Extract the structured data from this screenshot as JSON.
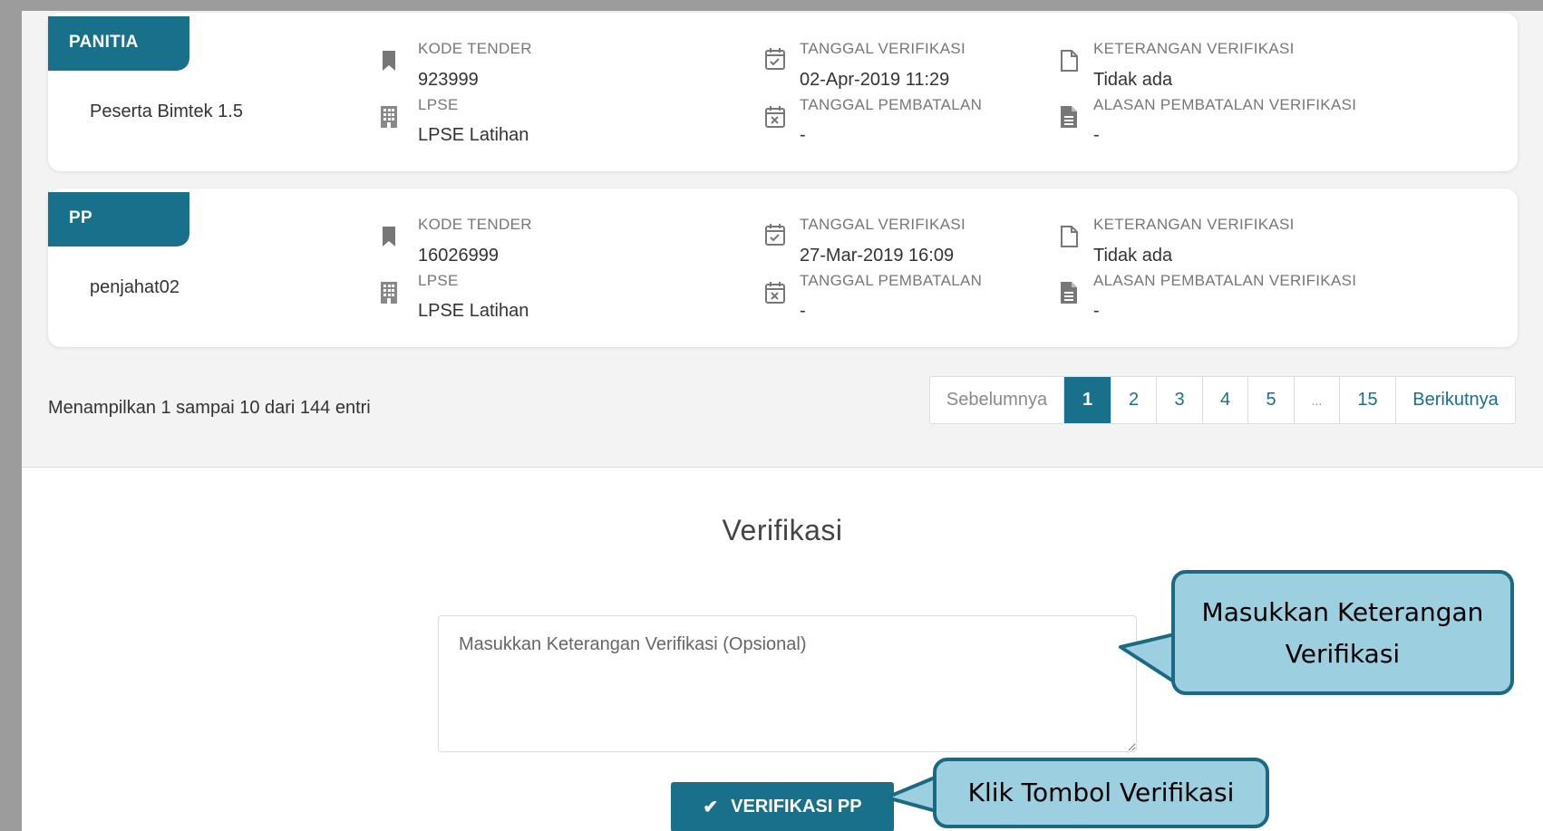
{
  "cards": [
    {
      "role": "PANITIA",
      "name": "Peserta Bimtek 1.5",
      "kode_tender_label": "KODE TENDER",
      "kode_tender": "923999",
      "lpse_label": "LPSE",
      "lpse": "LPSE Latihan",
      "tgl_verifikasi_label": "TANGGAL VERIFIKASI",
      "tgl_verifikasi": "02-Apr-2019 11:29",
      "tgl_pembatalan_label": "TANGGAL PEMBATALAN",
      "tgl_pembatalan": "-",
      "keterangan_label": "KETERANGAN VERIFIKASI",
      "keterangan": "Tidak ada",
      "alasan_label": "ALASAN PEMBATALAN VERIFIKASI",
      "alasan": "-"
    },
    {
      "role": "PP",
      "name": "penjahat02",
      "kode_tender_label": "KODE TENDER",
      "kode_tender": "16026999",
      "lpse_label": "LPSE",
      "lpse": "LPSE Latihan",
      "tgl_verifikasi_label": "TANGGAL VERIFIKASI",
      "tgl_verifikasi": "27-Mar-2019 16:09",
      "tgl_pembatalan_label": "TANGGAL PEMBATALAN",
      "tgl_pembatalan": "-",
      "keterangan_label": "KETERANGAN VERIFIKASI",
      "keterangan": "Tidak ada",
      "alasan_label": "ALASAN PEMBATALAN VERIFIKASI",
      "alasan": "-"
    }
  ],
  "info": "Menampilkan 1 sampai 10 dari 144 entri",
  "pagination": {
    "prev": "Sebelumnya",
    "pages": [
      "1",
      "2",
      "3",
      "4",
      "5",
      "...",
      "15"
    ],
    "active": "1",
    "next": "Berikutnya"
  },
  "verification": {
    "heading": "Verifikasi",
    "textarea_placeholder": "Masukkan Keterangan Verifikasi (Opsional)",
    "button_label": "VERIFIKASI PP",
    "button_icon": "check-icon"
  },
  "callouts": {
    "textarea_note_line1": "Masukkan Keterangan",
    "textarea_note_line2": "Verifikasi",
    "button_note": "Klik Tombol Verifikasi"
  },
  "colors": {
    "primary": "#18708a",
    "callout_fill": "#9ccfe0",
    "callout_border": "#1b6a84"
  },
  "icons": {
    "kode_tender": "bookmark-icon",
    "lpse": "building-icon",
    "tgl_verifikasi": "calendar-check-icon",
    "tgl_pembatalan": "calendar-x-icon",
    "keterangan": "document-outline-icon",
    "alasan": "document-filled-icon"
  }
}
